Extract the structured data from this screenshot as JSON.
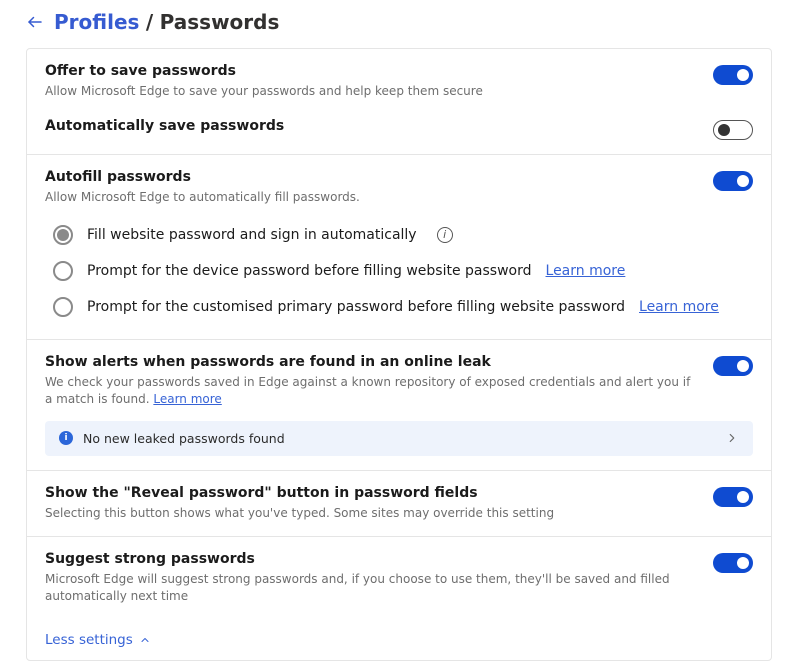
{
  "breadcrumb": {
    "parent": "Profiles",
    "sep": "/",
    "current": "Passwords"
  },
  "sections": {
    "offer": {
      "title": "Offer to save passwords",
      "desc": "Allow Microsoft Edge to save your passwords and help keep them secure"
    },
    "autosave": {
      "title": "Automatically save passwords"
    },
    "autofill": {
      "title": "Autofill passwords",
      "desc": "Allow Microsoft Edge to automatically fill passwords.",
      "opt1": "Fill website password and sign in automatically",
      "opt2": "Prompt for the device password before filling website password",
      "opt2_link": "Learn more",
      "opt3": "Prompt for the customised primary password before filling website password",
      "opt3_link": "Learn more"
    },
    "leak": {
      "title": "Show alerts when passwords are found in an online leak",
      "desc": "We check your passwords saved in Edge against a known repository of exposed credentials and alert you if a match is found. ",
      "desc_link": "Learn more",
      "banner": "No new leaked passwords found"
    },
    "reveal": {
      "title": "Show the \"Reveal password\" button in password fields",
      "desc": "Selecting this button shows what you've typed. Some sites may override this setting"
    },
    "suggest": {
      "title": "Suggest strong passwords",
      "desc": "Microsoft Edge will suggest strong passwords and, if you choose to use them, they'll be saved and filled automatically next time"
    }
  },
  "less_settings": "Less settings"
}
